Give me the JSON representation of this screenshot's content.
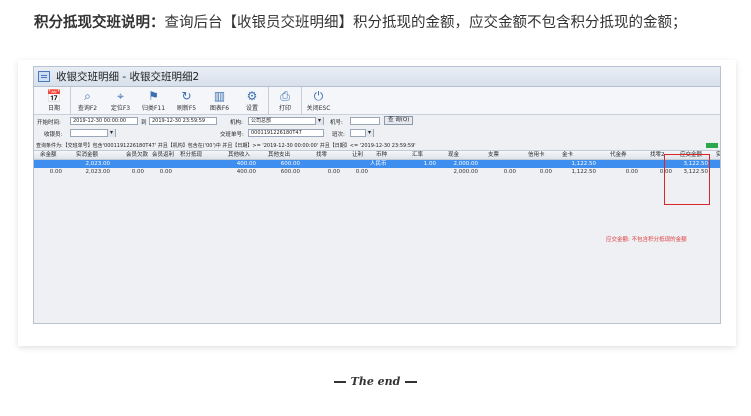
{
  "intro": {
    "bold_label": "积分抵现交班说明：",
    "text": "查询后台【收银员交班明细】积分抵现的金额，应交金额不包含积分抵现的金额；"
  },
  "window": {
    "title": "收银交班明细 - 收银交班明细2",
    "toolbar": [
      {
        "icon": "calendar-icon",
        "glyph": "📅",
        "label": "日期"
      },
      {
        "icon": "search-icon",
        "glyph": "⌕",
        "label": "查询F2"
      },
      {
        "icon": "location-icon",
        "glyph": "⌖",
        "label": "定位F3"
      },
      {
        "icon": "flag-icon",
        "glyph": "⚑",
        "label": "归类F11"
      },
      {
        "icon": "refresh-icon",
        "glyph": "↻",
        "label": "刷新F5"
      },
      {
        "icon": "chart-icon",
        "glyph": "▥",
        "label": "图表F6"
      },
      {
        "icon": "gear-icon",
        "glyph": "⚙",
        "label": "设置"
      },
      {
        "icon": "print-icon",
        "glyph": "⎙",
        "label": "打印"
      },
      {
        "icon": "power-icon",
        "glyph": "⏻",
        "label": "关闭ESC"
      }
    ],
    "filters": {
      "start_label": "开始时间:",
      "start_value": "2019-12-30 00:00:00",
      "to_label": "到",
      "end_value": "2019-12-30 23:59:59",
      "org_label": "机构:",
      "org_value": "公司总部",
      "machine_label": "机号:",
      "query_button": "查 询(Q)",
      "cashier_label": "收银员:",
      "cashier_value": "",
      "shift_no_label": "交班单号:",
      "shift_no_value": "000119122618​0T47",
      "shift_label": "班次:"
    },
    "condition": "查询条件为:【交班单号】包含'0001191226180T47' 并且【机构】包含在('00')中 并且【日期】>= '2019-12-30 00:00:00' 并且【日期】<= '2019-12-30 23:59:59'",
    "columns": [
      "余金额",
      "实消金额",
      "会员欠款",
      "会员返利",
      "积分抵现",
      "其他收入",
      "其他支出",
      "找零",
      "让利",
      "币种",
      "汇率",
      "现金",
      "支票",
      "信用卡",
      "金卡",
      "代金券",
      "找零2",
      "应交金额",
      "实交金"
    ],
    "rows": [
      [
        "",
        "2,023.00",
        "",
        "",
        "",
        "400.00",
        "600.00",
        "",
        "",
        "人民币",
        "1.00",
        "2,000.00",
        "",
        "",
        "1,122.50",
        "",
        "",
        "3,122.50",
        ""
      ],
      [
        "0.00",
        "2,023.00",
        "0.00",
        "0.00",
        "",
        "400.00",
        "600.00",
        "0.00",
        "0.00",
        "",
        "",
        "2,000.00",
        "0.00",
        "0.00",
        "1,122.50",
        "0.00",
        "0.00",
        "3,122.50",
        ""
      ]
    ],
    "annotation": "应交金额: 不包含积分抵现的金额"
  },
  "footer": {
    "the_end": "The end"
  }
}
